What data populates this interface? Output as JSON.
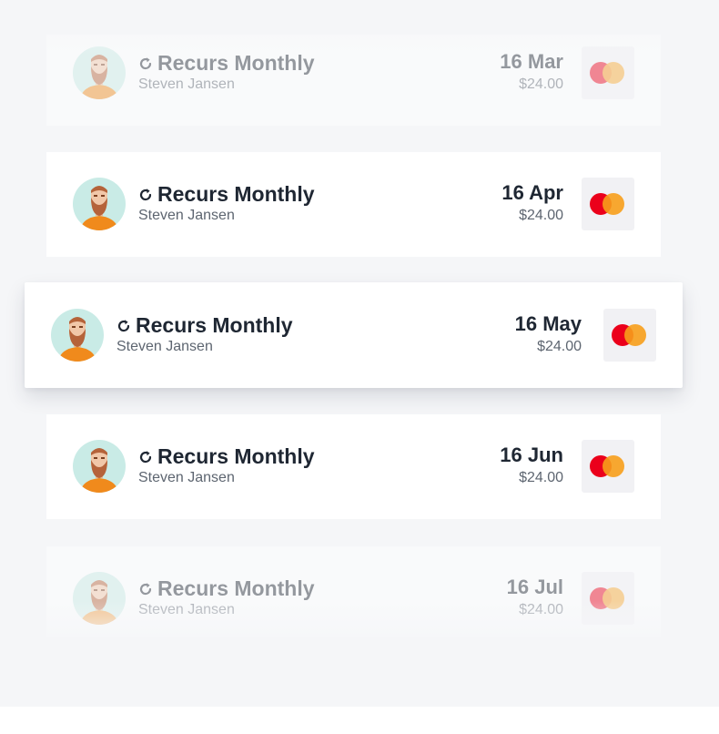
{
  "payments": [
    {
      "title": "Recurs Monthly",
      "name": "Steven Jansen",
      "date": "16 Mar",
      "amount": "$24.00"
    },
    {
      "title": "Recurs Monthly",
      "name": "Steven Jansen",
      "date": "16 Apr",
      "amount": "$24.00"
    },
    {
      "title": "Recurs Monthly",
      "name": "Steven Jansen",
      "date": "16 May",
      "amount": "$24.00"
    },
    {
      "title": "Recurs Monthly",
      "name": "Steven Jansen",
      "date": "16 Jun",
      "amount": "$24.00"
    },
    {
      "title": "Recurs Monthly",
      "name": "Steven Jansen",
      "date": "16 Jul",
      "amount": "$24.00"
    }
  ],
  "icons": {
    "recur": "recurring-icon",
    "avatar": "avatar-bearded-man",
    "card_brand": "mastercard-icon"
  },
  "colors": {
    "avatar_bg": "#c9ebe6",
    "shirt": "#f08a1c",
    "mastercard_red": "#eb001b",
    "mastercard_orange": "#f79e1b",
    "text_primary": "#1f2733",
    "text_secondary": "#5d6570"
  }
}
